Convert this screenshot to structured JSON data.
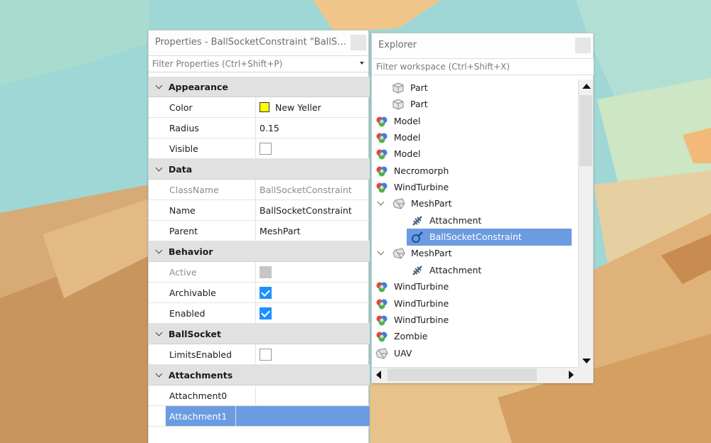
{
  "properties_panel": {
    "title": "Properties - BallSocketConstraint \"BallSock...",
    "filter_placeholder": "Filter Properties (Ctrl+Shift+P)",
    "categories": [
      {
        "label": "Appearance"
      },
      {
        "label": "Data"
      },
      {
        "label": "Behavior"
      },
      {
        "label": "BallSocket"
      },
      {
        "label": "Attachments"
      }
    ],
    "rows": {
      "color": {
        "name": "Color",
        "value": "New Yeller",
        "swatch": "#ffff00"
      },
      "radius": {
        "name": "Radius",
        "value": "0.15"
      },
      "visible": {
        "name": "Visible",
        "checked": false
      },
      "classname": {
        "name": "ClassName",
        "value": "BallSocketConstraint"
      },
      "name": {
        "name": "Name",
        "value": "BallSocketConstraint"
      },
      "parent": {
        "name": "Parent",
        "value": "MeshPart"
      },
      "active": {
        "name": "Active",
        "checked": false
      },
      "archivable": {
        "name": "Archivable",
        "checked": true
      },
      "enabled": {
        "name": "Enabled",
        "checked": true
      },
      "limits_enabled": {
        "name": "LimitsEnabled",
        "checked": false
      },
      "attachment0": {
        "name": "Attachment0",
        "value": ""
      },
      "attachment1": {
        "name": "Attachment1",
        "value": ""
      }
    }
  },
  "explorer_panel": {
    "title": "Explorer",
    "filter_placeholder": "Filter workspace (Ctrl+Shift+X)",
    "items": [
      {
        "label": "Part",
        "icon": "part-icon"
      },
      {
        "label": "Part",
        "icon": "part-icon"
      },
      {
        "label": "Model",
        "icon": "model-icon"
      },
      {
        "label": "Model",
        "icon": "model-icon"
      },
      {
        "label": "Model",
        "icon": "model-icon"
      },
      {
        "label": "Necromorph",
        "icon": "model-icon"
      },
      {
        "label": "WindTurbine",
        "icon": "model-icon"
      },
      {
        "label": "MeshPart",
        "icon": "meshpart-icon"
      },
      {
        "label": "Attachment",
        "icon": "attachment-icon"
      },
      {
        "label": "BallSocketConstraint",
        "icon": "ballsocket-icon"
      },
      {
        "label": "MeshPart",
        "icon": "meshpart-icon"
      },
      {
        "label": "Attachment",
        "icon": "attachment-icon"
      },
      {
        "label": "WindTurbine",
        "icon": "model-icon"
      },
      {
        "label": "WindTurbine",
        "icon": "model-icon"
      },
      {
        "label": "WindTurbine",
        "icon": "model-icon"
      },
      {
        "label": "Zombie",
        "icon": "model-icon"
      },
      {
        "label": "UAV",
        "icon": "meshpart-icon"
      }
    ]
  },
  "colors": {
    "selection": "#6b9be0",
    "checkbox_checked": "#1e90ff",
    "category_bg": "#e1e1e1"
  }
}
